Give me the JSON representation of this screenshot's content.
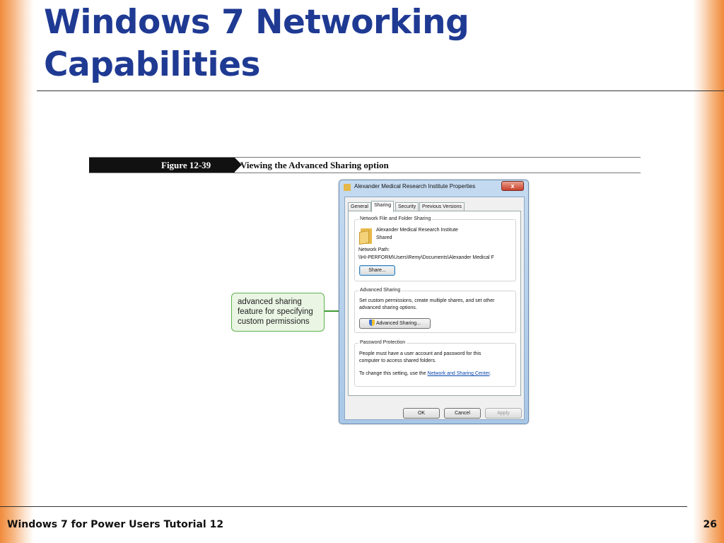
{
  "slide": {
    "title": "Windows 7 Networking Capabilities",
    "footer_left": "Windows 7 for Power Users Tutorial 12",
    "page_number": "26"
  },
  "figure": {
    "label": "Figure 12-39",
    "caption": "Viewing the Advanced Sharing option"
  },
  "callout": {
    "text": "advanced sharing feature for specifying custom permissions"
  },
  "dialog": {
    "title": "Alexander Medical Research Institute Properties",
    "close_label": "x",
    "tabs": [
      {
        "label": "General",
        "active": false
      },
      {
        "label": "Sharing",
        "active": true
      },
      {
        "label": "Security",
        "active": false
      },
      {
        "label": "Previous Versions",
        "active": false
      }
    ],
    "network_sharing": {
      "group_label": "Network File and Folder Sharing",
      "folder_name": "Alexander Medical Research Institute",
      "status": "Shared",
      "path_label": "Network Path:",
      "path_value": "\\\\HI-PERFORM\\Users\\Remy\\Documents\\Alexander Medical F",
      "share_button": "Share..."
    },
    "advanced_sharing": {
      "group_label": "Advanced Sharing",
      "description_line1": "Set custom permissions, create multiple shares, and set other",
      "description_line2": "advanced sharing options.",
      "button_label": "Advanced Sharing..."
    },
    "password_protection": {
      "group_label": "Password Protection",
      "line1": "People must have a user account and password for this",
      "line2": "computer to access shared folders.",
      "change_prefix": "To change this setting, use the ",
      "link_text": "Network and Sharing Center",
      "change_suffix": "."
    },
    "buttons": {
      "ok": "OK",
      "cancel": "Cancel",
      "apply": "Apply"
    }
  },
  "colors": {
    "title_blue": "#1f3a93",
    "accent_orange": "#f08a3c",
    "callout_green": "#5fb14f",
    "link_blue": "#0645ad"
  }
}
